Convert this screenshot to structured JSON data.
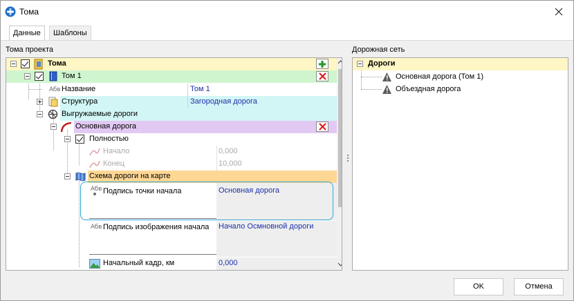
{
  "window": {
    "title": "Тома"
  },
  "tabs": [
    {
      "label": "Данные"
    },
    {
      "label": "Шаблоны"
    }
  ],
  "left_panel": {
    "title": "Тома проекта",
    "root": {
      "label": "Тома"
    },
    "volume": {
      "label": "Том 1",
      "name_label": "Название",
      "name_value": "Том 1",
      "structure_label": "Структура",
      "structure_value": "Загородная дорога",
      "exported_label": "Выгружаемые дороги",
      "road": {
        "label": "Основная дорога",
        "full_label": "Полностью",
        "start_label": "Начало",
        "start_value": "0,000",
        "end_label": "Конец",
        "end_value": "10,000",
        "scheme_label": "Схема дороги на карте",
        "start_caption_label": "Подпись точки начала",
        "start_caption_value": "Основная дорога",
        "image_caption_label": "Подпись изображения начала",
        "image_caption_value": "Начало Осмновной дороги",
        "start_frame_label": "Начальный кадр, км",
        "start_frame_value": "0,000"
      }
    },
    "abbrev": "Абв"
  },
  "right_panel": {
    "title": "Дорожная сеть",
    "root": {
      "label": "Дороги"
    },
    "items": [
      {
        "label": "Основная дорога (Том 1)"
      },
      {
        "label": "Объездная дорога"
      }
    ]
  },
  "buttons": {
    "ok": "OK",
    "cancel": "Отмена"
  },
  "colors": {
    "root_row": "#fef6c4",
    "volume_row": "#cff5cf",
    "structure_row": "#d2f6f6",
    "road_row": "#e2c9f3",
    "scheme_row": "#fed795",
    "disabled": "#a9a9a9",
    "value": "#1c2fa8",
    "highlight": "#2da7d6",
    "delete": "#d9191b",
    "add": "#1f9a23"
  }
}
